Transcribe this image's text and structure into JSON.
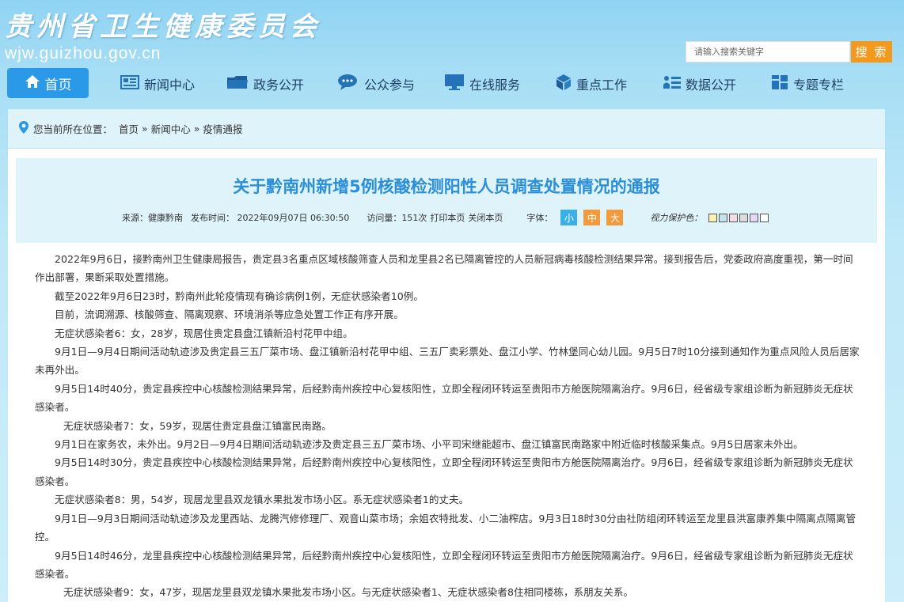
{
  "header": {
    "site_title": "贵州省卫生健康委员会",
    "site_url": "wjw.guizhou.gov.cn",
    "search_placeholder": "请输入搜索关键字",
    "search_button": "搜 索"
  },
  "nav": {
    "items": [
      {
        "label": "首页",
        "icon": "home-icon"
      },
      {
        "label": "新闻中心",
        "icon": "news-icon"
      },
      {
        "label": "政务公开",
        "icon": "folder-icon"
      },
      {
        "label": "公众参与",
        "icon": "chat-icon"
      },
      {
        "label": "在线服务",
        "icon": "monitor-icon"
      },
      {
        "label": "重点工作",
        "icon": "cube-icon"
      },
      {
        "label": "数据公开",
        "icon": "data-icon"
      },
      {
        "label": "专题专栏",
        "icon": "grid-icon"
      }
    ]
  },
  "breadcrumb": {
    "prefix": "您当前所在位置：",
    "items": [
      "首页",
      "新闻中心",
      "疫情通报"
    ],
    "separator": "»"
  },
  "article": {
    "title": "关于黔南州新增5例核酸检测阳性人员调查处置情况的通报",
    "source": "来源：健康黔南",
    "publish_time": "发布时间： 2022年09月07日 06:30:50",
    "views": "访问量：151次",
    "print_link": "打印本页",
    "close_link": "关闭本页",
    "font_label": "字体：",
    "font_small": "小",
    "font_medium": "中",
    "font_large": "大",
    "vision_label": "视力保护色：",
    "vision_colors": [
      "#fdf1b0",
      "#c5e3ee",
      "#f4dde0",
      "#dcdcdc",
      "#e6d7f2",
      "#ffffff"
    ],
    "paragraphs": [
      "2022年9月6日，接黔南州卫生健康局报告，贵定县3名重点区域核酸筛查人员和龙里县2名已隔离管控的人员新冠病毒核酸检测结果异常。接到报告后，党委政府高度重视，第一时间作出部署，果断采取处置措施。",
      "截至2022年9月6日23时，黔南州此轮疫情现有确诊病例1例，无症状感染者10例。",
      "目前，流调溯源、核酸筛查、隔离观察、环境消杀等应急处置工作正有序开展。",
      "无症状感染者6：女，28岁，现居住贵定县盘江镇新沿村花甲中组。",
      "9月1日—9月4日期间活动轨迹涉及贵定县三五厂菜市场、盘江镇新沿村花甲中组、三五厂卖彩票处、盘江小学、竹林堡同心幼儿园。9月5日7时10分接到通知作为重点风险人员后居家未再外出。",
      "9月5日14时40分，贵定县疾控中心核酸检测结果异常，后经黔南州疾控中心复核阳性，立即全程闭环转运至贵阳市方舱医院隔离治疗。9月6日，经省级专家组诊断为新冠肺炎无症状感染者。",
      "无症状感染者7：女，59岁，现居住贵定县盘江镇富民南路。",
      "9月1日在家务农，未外出。9月2日—9月4日期间活动轨迹涉及贵定县三五厂菜市场、小平司宋继能超市、盘江镇富民南路家中附近临时核酸采集点。9月5日居家未外出。",
      "9月5日14时30分，贵定县疾控中心核酸检测结果异常，后经黔南州疾控中心复核阳性，立即全程闭环转运至贵阳市方舱医院隔离治疗。9月6日，经省级专家组诊断为新冠肺炎无症状感染者。",
      "无症状感染者8：男，54岁，现居龙里县双龙镇水果批发市场小区。系无症状感染者1的丈夫。",
      "9月1日—9月3日期间活动轨迹涉及龙里西站、龙腾汽修修理厂、观音山菜市场；余姐农特批发、小二油榨店。9月3日18时30分由社防组闭环转运至龙里县洪富康养集中隔离点隔离管控。",
      "9月5日14时46分，龙里县疾控中心核酸检测结果异常，后经黔南州疾控中心复核阳性，立即全程闭环转运至贵阳市方舱医院隔离治疗。9月6日，经省级专家组诊断为新冠肺炎无症状感染者。",
      "无症状感染者9：女，47岁，现居龙里县双龙镇水果批发市场小区。与无症状感染者1、无症状感染者8住相同楼栋，系朋友关系。"
    ]
  }
}
